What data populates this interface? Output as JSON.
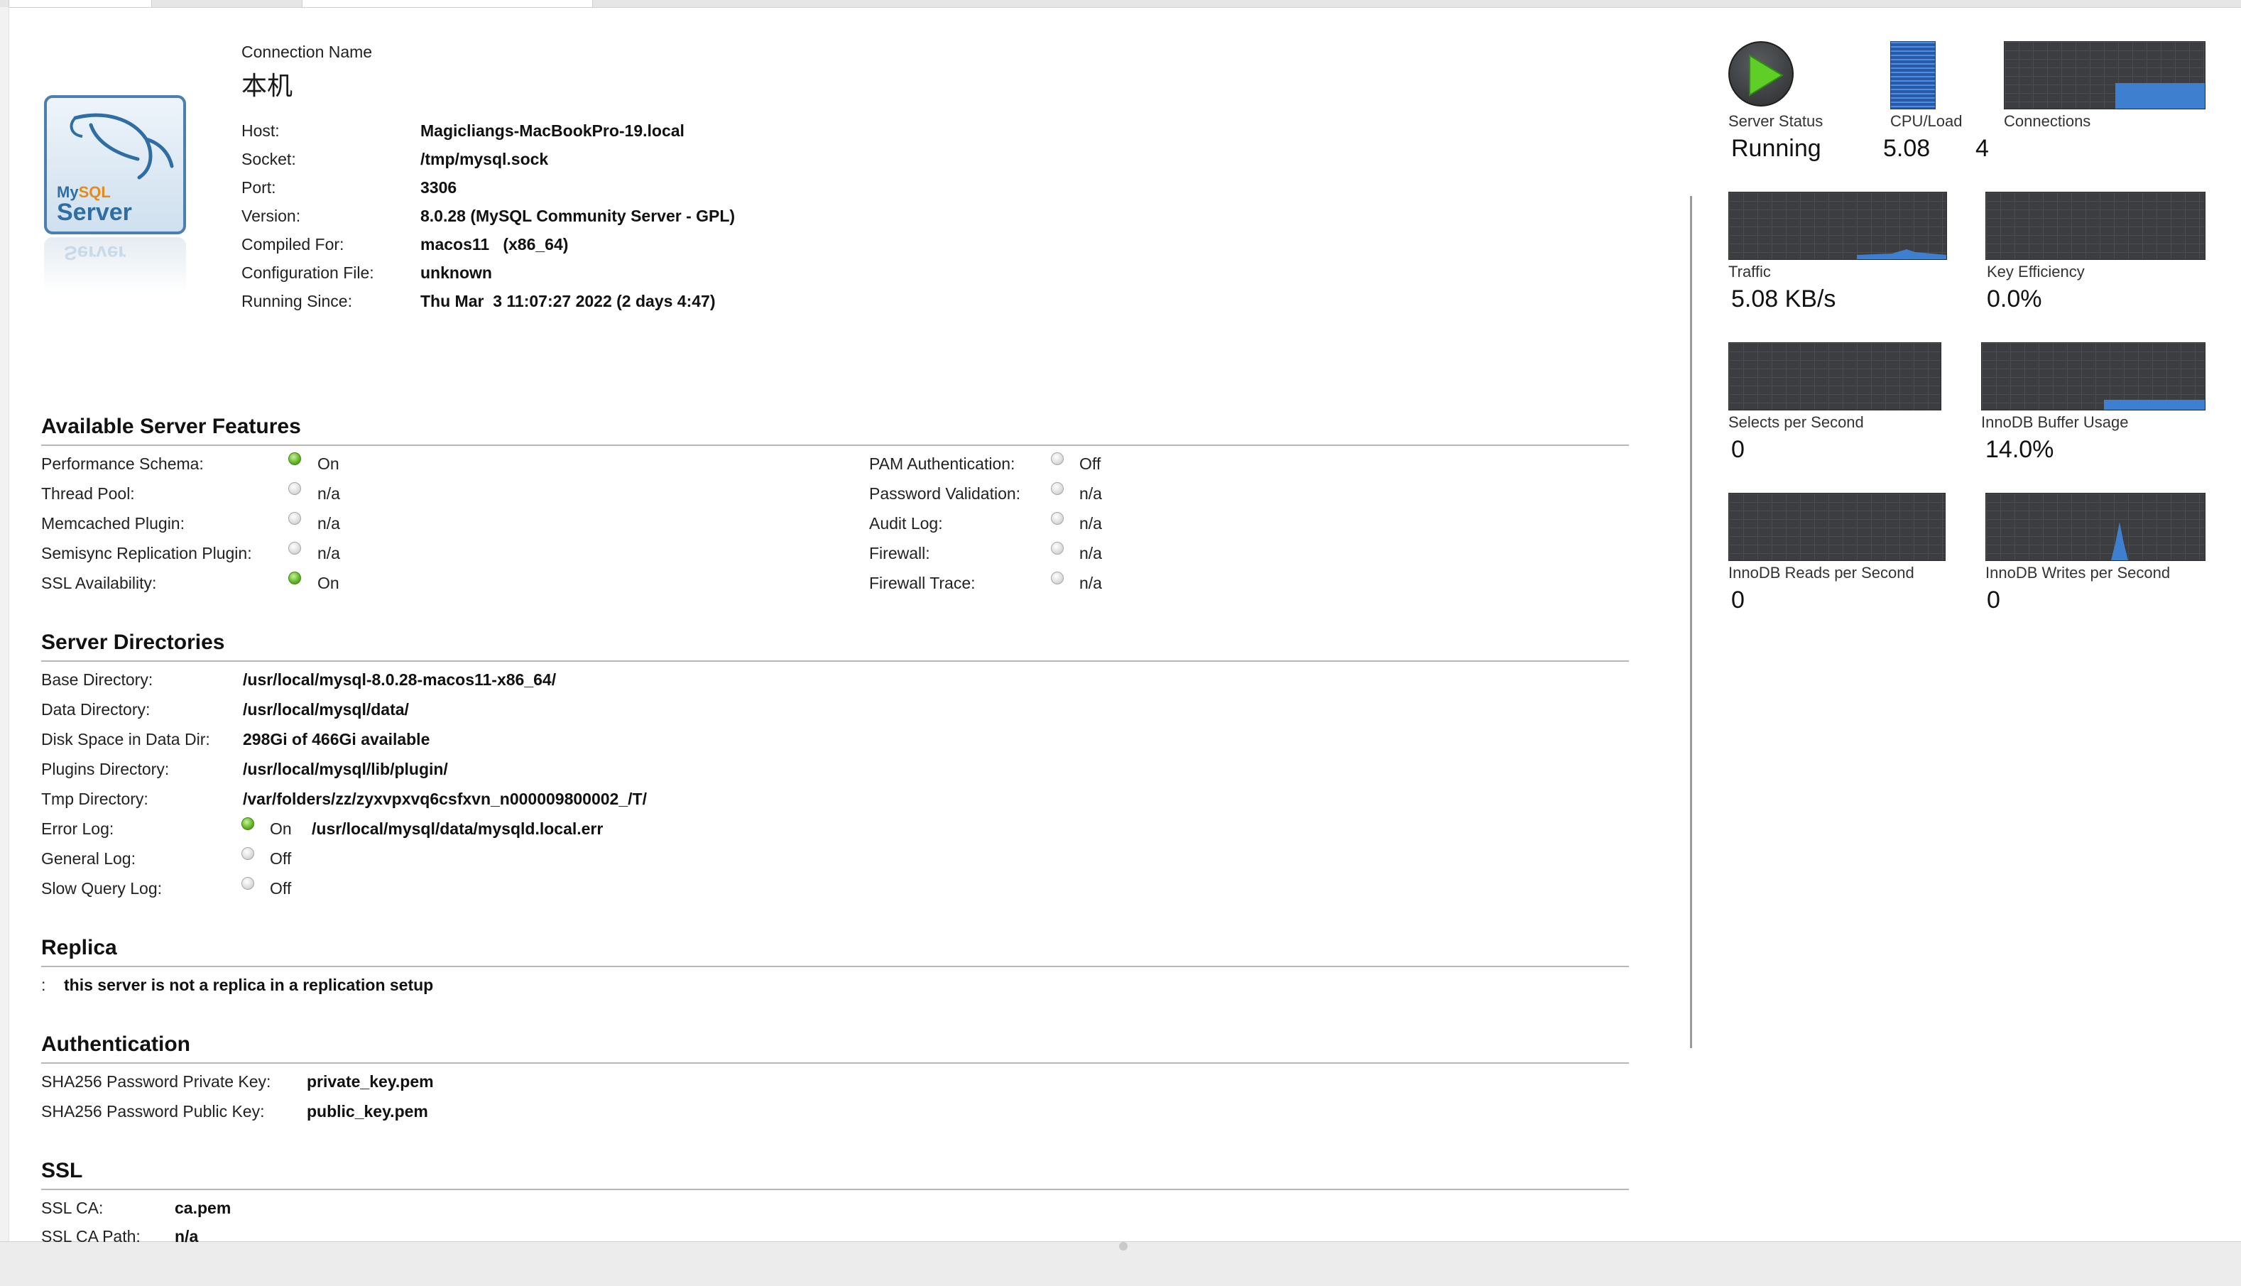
{
  "header": {
    "connection_name_label": "Connection Name",
    "connection_name": "本机",
    "logo_line1_my": "My",
    "logo_line1_sql": "SQL",
    "logo_line2": "Server",
    "info": [
      {
        "label": "Host:",
        "value": "Magicliangs-MacBookPro-19.local"
      },
      {
        "label": "Socket:",
        "value": "/tmp/mysql.sock"
      },
      {
        "label": "Port:",
        "value": "3306"
      },
      {
        "label": "Version:",
        "value": "8.0.28 (MySQL Community Server - GPL)"
      },
      {
        "label": "Compiled For:",
        "value": "macos11   (x86_64)"
      },
      {
        "label": "Configuration File:",
        "value": "unknown"
      },
      {
        "label": "Running Since:",
        "value": "Thu Mar  3 11:07:27 2022 (2 days 4:47)"
      }
    ]
  },
  "features": {
    "title": "Available Server Features",
    "left": [
      {
        "label": "Performance Schema:",
        "state": "on",
        "value": "On"
      },
      {
        "label": "Thread Pool:",
        "state": "off",
        "value": "n/a"
      },
      {
        "label": "Memcached Plugin:",
        "state": "off",
        "value": "n/a"
      },
      {
        "label": "Semisync Replication Plugin:",
        "state": "off",
        "value": "n/a"
      },
      {
        "label": "SSL Availability:",
        "state": "on",
        "value": "On"
      }
    ],
    "right": [
      {
        "label": "PAM Authentication:",
        "state": "off",
        "value": "Off"
      },
      {
        "label": "Password Validation:",
        "state": "off",
        "value": "n/a"
      },
      {
        "label": "Audit Log:",
        "state": "off",
        "value": "n/a"
      },
      {
        "label": "Firewall:",
        "state": "off",
        "value": "n/a"
      },
      {
        "label": "Firewall Trace:",
        "state": "off",
        "value": "n/a"
      }
    ]
  },
  "directories": {
    "title": "Server Directories",
    "rows": [
      {
        "label": "Base Directory:",
        "value": "/usr/local/mysql-8.0.28-macos11-x86_64/"
      },
      {
        "label": "Data Directory:",
        "value": "/usr/local/mysql/data/"
      },
      {
        "label": "Disk Space in Data Dir:",
        "value": "298Gi of 466Gi available"
      },
      {
        "label": "Plugins Directory:",
        "value": "/usr/local/mysql/lib/plugin/"
      },
      {
        "label": "Tmp Directory:",
        "value": "/var/folders/zz/zyxvpxvq6csfxvn_n000009800002_/T/"
      }
    ],
    "logs": [
      {
        "label": "Error Log:",
        "state": "on",
        "status": "On",
        "path": "/usr/local/mysql/data/mysqld.local.err"
      },
      {
        "label": "General Log:",
        "state": "off",
        "status": "Off",
        "path": ""
      },
      {
        "label": "Slow Query Log:",
        "state": "off",
        "status": "Off",
        "path": ""
      }
    ]
  },
  "replica": {
    "title": "Replica",
    "colon": ":",
    "text": "this server is not a replica in a replication setup"
  },
  "authentication": {
    "title": "Authentication",
    "rows": [
      {
        "label": "SHA256 Password Private Key:",
        "value": "private_key.pem"
      },
      {
        "label": "SHA256 Password Public Key:",
        "value": "public_key.pem"
      }
    ]
  },
  "ssl": {
    "title": "SSL",
    "rows": [
      {
        "label": "SSL CA:",
        "value": "ca.pem"
      },
      {
        "label": "SSL CA Path:",
        "value": "n/a"
      }
    ]
  },
  "dashboard": {
    "server_status_label": "Server Status",
    "server_status_value": "Running",
    "cpu_label": "CPU/Load",
    "cpu_value": "5.08",
    "connections_label": "Connections",
    "connections_value": "4",
    "traffic_label": "Traffic",
    "traffic_value": "5.08 KB/s",
    "key_eff_label": "Key Efficiency",
    "key_eff_value": "0.0%",
    "selects_label": "Selects per Second",
    "selects_value": "0",
    "buffer_label": "InnoDB Buffer Usage",
    "buffer_value": "14.0%",
    "reads_label": "InnoDB Reads per Second",
    "reads_value": "0",
    "writes_label": "InnoDB Writes per Second",
    "writes_value": "0",
    "colors": {
      "graph_bg": "#3b3d40",
      "graph_fill": "#3f7fd0",
      "running_green": "#5fcf28"
    }
  }
}
